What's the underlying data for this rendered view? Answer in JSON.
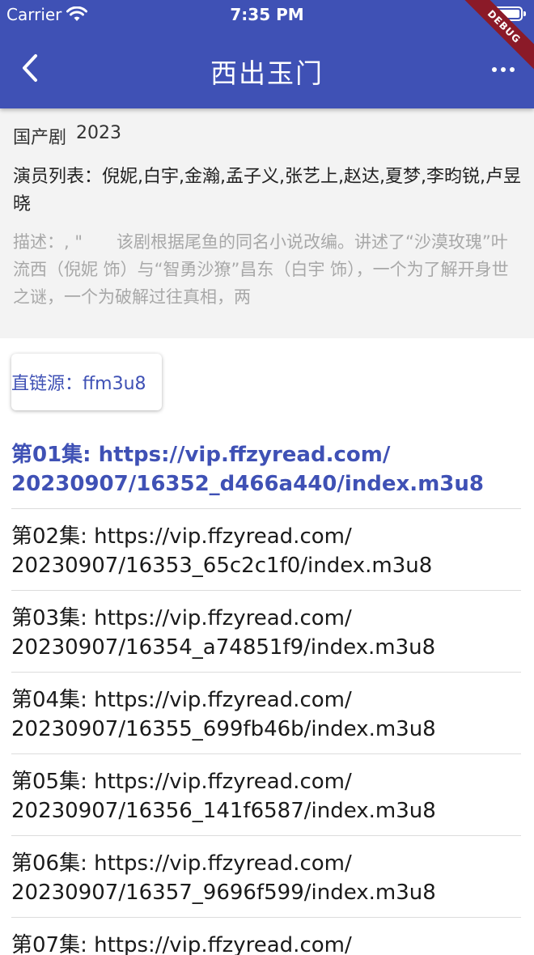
{
  "status_bar": {
    "carrier": "Carrier",
    "time": "7:35 PM"
  },
  "debug_banner": "DEBUG",
  "app_bar": {
    "title": "西出玉门",
    "back_icon": "chevron-left-icon",
    "more_icon": "more-horizontal-icon",
    "color": "#3f51b5"
  },
  "info": {
    "genre": "国产剧",
    "year": "2023",
    "cast": "演员列表：倪妮,白宇,金瀚,孟子义,张艺上,赵达,夏梦,李昀锐,卢昱晓",
    "description": "描述：, \"　　该剧根据尾鱼的同名小说改编。讲述了“沙漠玫瑰”叶流西（倪妮 饰）与“智勇沙獠”昌东（白宇 饰），一个为了解开身世之谜，一个为破解过往真相，两"
  },
  "source": {
    "label": "直链源：ffm3u8"
  },
  "episodes": [
    {
      "label": "第01集: https://vip.ffzyread.com/\n20230907/16352_d466a440/index.m3u8",
      "active": true
    },
    {
      "label": "第02集: https://vip.ffzyread.com/\n20230907/16353_65c2c1f0/index.m3u8",
      "active": false
    },
    {
      "label": "第03集: https://vip.ffzyread.com/\n20230907/16354_a74851f9/index.m3u8",
      "active": false
    },
    {
      "label": "第04集: https://vip.ffzyread.com/\n20230907/16355_699fb46b/index.m3u8",
      "active": false
    },
    {
      "label": "第05集: https://vip.ffzyread.com/\n20230907/16356_141f6587/index.m3u8",
      "active": false
    },
    {
      "label": "第06集: https://vip.ffzyread.com/\n20230907/16357_9696f599/index.m3u8",
      "active": false
    },
    {
      "label": "第07集: https://vip.ffzyread.com/",
      "active": false
    }
  ]
}
